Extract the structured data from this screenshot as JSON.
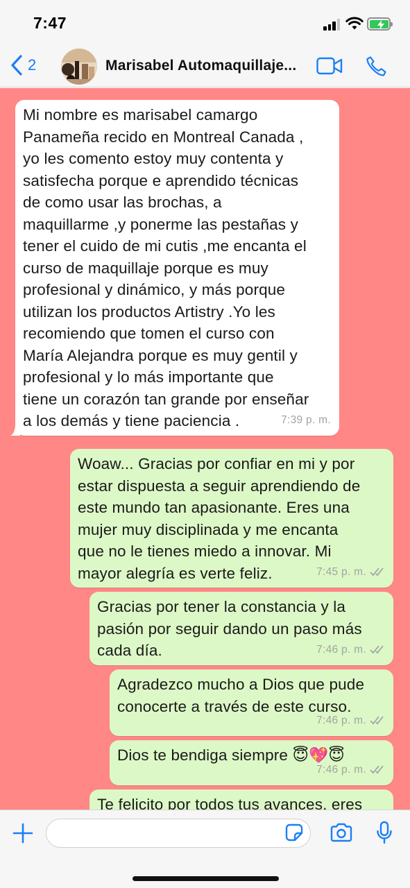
{
  "status_bar": {
    "time": "7:47"
  },
  "header": {
    "back_count": "2",
    "title": "Marisabel Automaquillaje..."
  },
  "messages": [
    {
      "direction": "incoming",
      "text": "Mi nombre es marisabel camargo\nPanameña recido en Montreal Canada ,\nyo les comento estoy muy contenta y\nsatisfecha porque e aprendido técnicas\nde como usar las brochas,  a\nmaquillarme ,y ponerme las pestañas y\ntener el cuido de mi cutis ,me encanta el\ncurso de maquillaje porque es muy\nprofesional y dinámico, y más porque\nutilizan los productos Artistry .Yo les\nrecomiendo que tomen el curso con\nMaría Alejandra porque es muy gentil y\nprofesional y lo más importante que\ntiene un corazón tan grande por enseñar\na los demás y tiene paciencia .",
      "time": "7:39 p. m."
    },
    {
      "direction": "outgoing",
      "text": "Woaw... Gracias por confiar en mi y por\nestar dispuesta a seguir aprendiendo de\neste mundo tan apasionante. Eres una\nmujer muy disciplinada y me encanta\nque no le tienes miedo a innovar. Mi\nmayor alegría es verte feliz.",
      "time": "7:45 p. m."
    },
    {
      "direction": "outgoing",
      "text": "Gracias por tener la constancia y la\npasión por seguir dando un paso más\ncada día.",
      "time": "7:46 p. m."
    },
    {
      "direction": "outgoing",
      "text": "Agradezco mucho a Dios que pude\nconocerte a través de este curso.",
      "time": "7:46 p. m."
    },
    {
      "direction": "outgoing",
      "text": "Dios te bendiga siempre 😇💖😇",
      "time": "7:46 p. m."
    },
    {
      "direction": "outgoing",
      "text": "Te felicito por todos tus avances, eres",
      "time": ""
    }
  ],
  "input": {
    "placeholder": ""
  },
  "icons": {
    "back": "chevron-left-icon",
    "video": "video-camera-icon",
    "phone": "phone-icon",
    "plus": "plus-icon",
    "sticker": "sticker-icon",
    "camera": "camera-icon",
    "mic": "microphone-icon"
  },
  "colors": {
    "accent": "#1a7ff5",
    "chat_background": "#ff8785",
    "incoming_bubble": "#ffffff",
    "outgoing_bubble": "#dcf8c6"
  }
}
